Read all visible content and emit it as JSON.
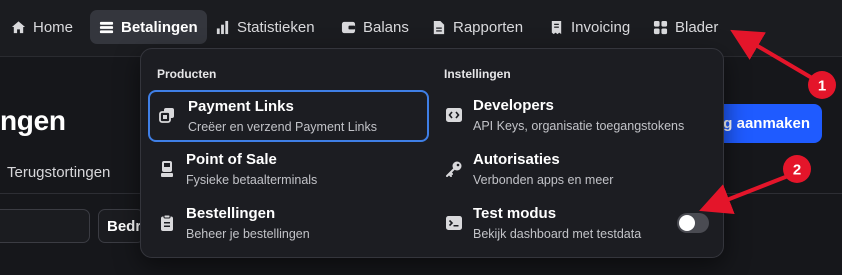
{
  "topnav": {
    "items": [
      {
        "label": "Home",
        "icon": "home-icon"
      },
      {
        "label": "Betalingen",
        "icon": "payments-icon",
        "active": true
      },
      {
        "label": "Statistieken",
        "icon": "bar-chart-icon"
      },
      {
        "label": "Balans",
        "icon": "wallet-icon"
      },
      {
        "label": "Rapporten",
        "icon": "document-icon"
      },
      {
        "label": "Invoicing",
        "icon": "receipt-icon"
      },
      {
        "label": "Blader",
        "icon": "grid-icon"
      }
    ]
  },
  "page": {
    "title_partial": "ngen",
    "subnav_partial": "Terugstortingen",
    "create_button_partial": "g aanmaken",
    "filter_partial": "Bedra"
  },
  "dropdown": {
    "left_heading": "Producten",
    "right_heading": "Instellingen",
    "left_items": [
      {
        "title": "Payment Links",
        "desc": "Creëer en verzend Payment Links",
        "icon": "payment-links-icon"
      },
      {
        "title": "Point of Sale",
        "desc": "Fysieke betaalterminals",
        "icon": "terminal-icon"
      },
      {
        "title": "Bestellingen",
        "desc": "Beheer je bestellingen",
        "icon": "clipboard-icon"
      }
    ],
    "right_items": [
      {
        "title": "Developers",
        "desc": "API Keys, organisatie toegangstokens",
        "icon": "code-icon"
      },
      {
        "title": "Autorisaties",
        "desc": "Verbonden apps en meer",
        "icon": "key-icon"
      },
      {
        "title": "Test modus",
        "desc": "Bekijk dashboard met testdata",
        "icon": "terminal-prompt-icon",
        "toggle": false
      }
    ]
  },
  "annotations": {
    "badge_1": "1",
    "badge_2": "2",
    "arrow_color": "#e4152a"
  },
  "colors": {
    "accent": "#1f5bff",
    "highlight_border": "#3f7fe6",
    "background": "#16171b"
  }
}
